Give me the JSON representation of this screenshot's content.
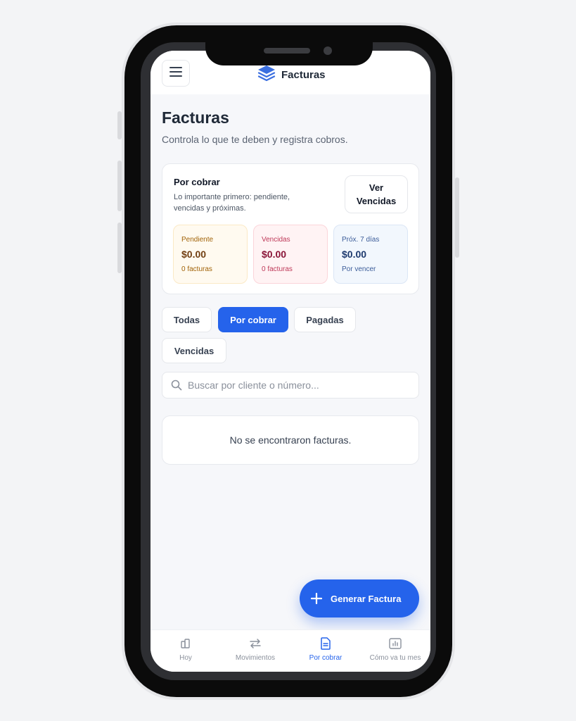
{
  "header": {
    "brand_title": "Facturas"
  },
  "page": {
    "title": "Facturas",
    "subtitle": "Controla lo que te deben y registra cobros."
  },
  "summary": {
    "title": "Por cobrar",
    "description": "Lo importante primero: pendiente, vencidas y próximas.",
    "view_button": "Ver Vencidas",
    "stats": [
      {
        "label": "Pendiente",
        "value": "$0.00",
        "note": "0 facturas"
      },
      {
        "label": "Vencidas",
        "value": "$0.00",
        "note": "0 facturas"
      },
      {
        "label": "Próx. 7 días",
        "value": "$0.00",
        "note": "Por vencer"
      }
    ]
  },
  "filters": {
    "active": "Por cobrar",
    "items": [
      "Todas",
      "Por cobrar",
      "Pagadas",
      "Vencidas"
    ]
  },
  "search": {
    "placeholder": "Buscar por cliente o número..."
  },
  "empty_message": "No se encontraron facturas.",
  "fab": {
    "label": "Generar Factura"
  },
  "bottom_nav": {
    "active": "Por cobrar",
    "items": [
      {
        "label": "Hoy",
        "icon": "home-icon"
      },
      {
        "label": "Movimientos",
        "icon": "swap-icon"
      },
      {
        "label": "Por cobrar",
        "icon": "document-icon"
      },
      {
        "label": "Cómo va tu mes",
        "icon": "chart-icon"
      }
    ]
  },
  "colors": {
    "primary": "#2563eb",
    "text": "#1f2937",
    "background": "#f6f7fa"
  }
}
